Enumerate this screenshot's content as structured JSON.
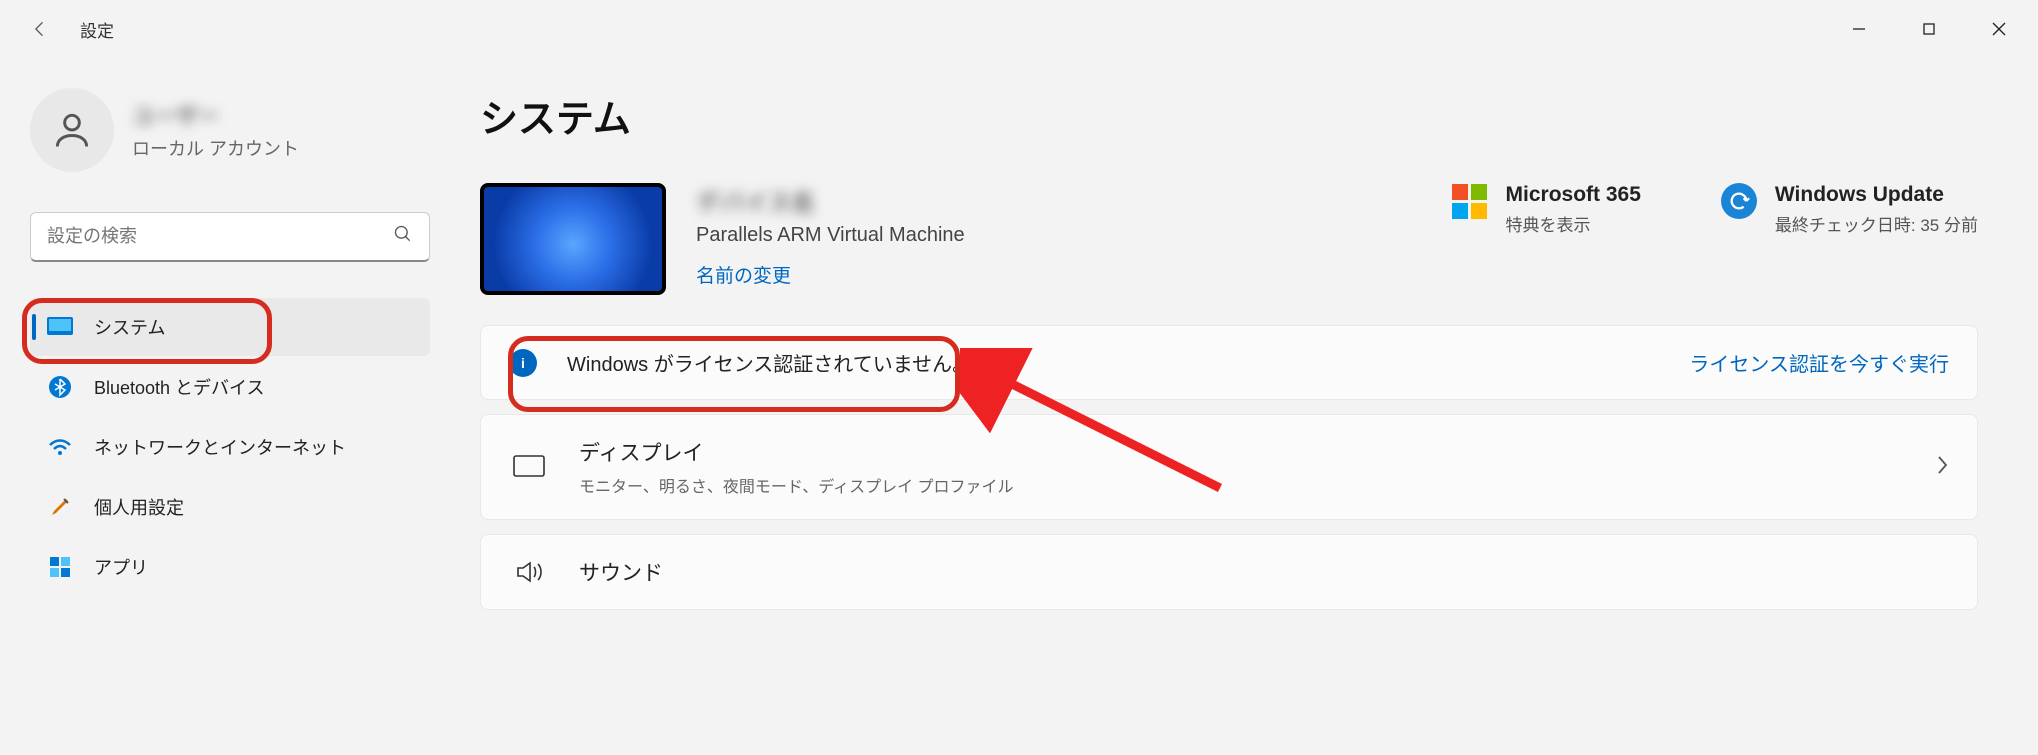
{
  "titlebar": {
    "app_title": "設定"
  },
  "account": {
    "name": "ユーザー",
    "sub": "ローカル アカウント"
  },
  "search": {
    "placeholder": "設定の検索"
  },
  "sidebar": {
    "items": [
      {
        "label": "システム"
      },
      {
        "label": "Bluetooth とデバイス"
      },
      {
        "label": "ネットワークとインターネット"
      },
      {
        "label": "個人用設定"
      },
      {
        "label": "アプリ"
      }
    ]
  },
  "page": {
    "title": "システム"
  },
  "device": {
    "name": "デバイス名",
    "sub": "Parallels ARM Virtual Machine",
    "rename": "名前の変更"
  },
  "cards": {
    "ms365": {
      "title": "Microsoft 365",
      "sub": "特典を表示"
    },
    "wu": {
      "title": "Windows Update",
      "sub": "最終チェック日時: 35 分前"
    }
  },
  "activation": {
    "msg": "Windows がライセンス認証されていません。",
    "link": "ライセンス認証を今すぐ実行"
  },
  "settings": {
    "display": {
      "title": "ディスプレイ",
      "sub": "モニター、明るさ、夜間モード、ディスプレイ プロファイル"
    },
    "sound": {
      "title": "サウンド"
    }
  }
}
